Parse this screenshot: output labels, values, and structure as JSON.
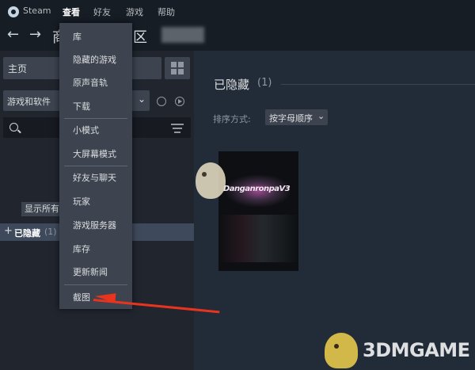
{
  "menubar": {
    "app_name": "Steam",
    "items": [
      "查看",
      "好友",
      "游戏",
      "帮助"
    ]
  },
  "navbar": {
    "back_arrow": "←",
    "forward_arrow": "→",
    "title_left": "商",
    "title_right": "区"
  },
  "left_panel": {
    "home_label": "主页",
    "filter_label": "游戏和软件",
    "filter_chevron": "⌄",
    "show_all_label": "显示所有",
    "hidden_group": {
      "plus": "+",
      "label": "已隐藏",
      "count": "(1)"
    }
  },
  "view_menu": {
    "items": [
      "库",
      "隐藏的游戏",
      "原声音轨",
      "下载",
      "小模式",
      "大屏幕模式",
      "好友与聊天",
      "玩家",
      "游戏服务器",
      "库存",
      "更新新闻",
      "截图"
    ]
  },
  "content": {
    "section_title": "已隐藏",
    "section_count": "(1)",
    "sort_label": "排序方式:",
    "sort_value": "按字母顺序",
    "sort_chevron": "⌄",
    "game_logo_text": "DanganronpaV3"
  },
  "watermark": {
    "text": "3DMGAME"
  },
  "colors": {
    "menubar_bg": "#171d25",
    "panel_bg": "#20252e",
    "content_bg": "#222b38",
    "menu_bg": "#3d4450",
    "highlight_row": "#3e4a5c",
    "annotation_arrow": "#e8341f"
  }
}
